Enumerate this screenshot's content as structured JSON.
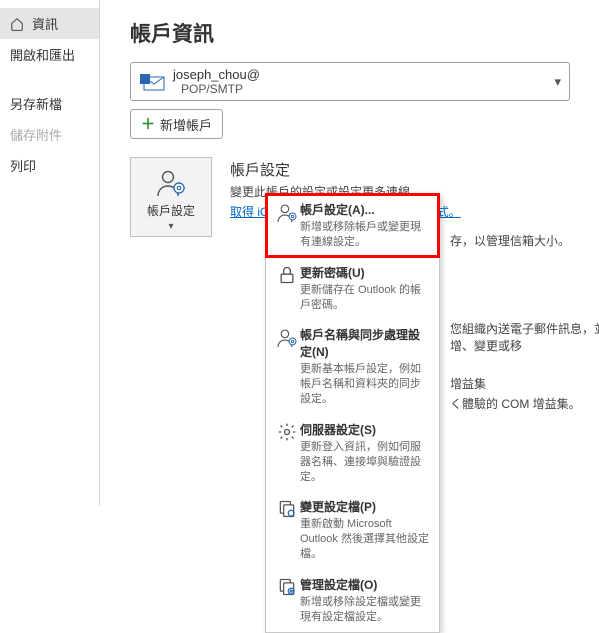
{
  "sidebar": {
    "items": [
      {
        "label": "資訊",
        "icon": "home"
      },
      {
        "label": "開啟和匯出"
      },
      {
        "label": "另存新檔"
      },
      {
        "label": "儲存附件"
      },
      {
        "label": "列印"
      }
    ]
  },
  "main": {
    "pageTitle": "帳戶資訊",
    "account": {
      "email": "joseph_chou@",
      "protocol": "POP/SMTP"
    },
    "addAccount": "新增帳戶",
    "settingsBtn": "帳戶設定",
    "settingsHeading": "帳戶設定",
    "settingsSub": "變更此帳戶的設定或設定更多連線。",
    "settingsLink": "取得 iOS 或 Android 版 Outlook 應用程式。"
  },
  "dropdown": {
    "items": [
      {
        "title": "帳戶設定(A)...",
        "desc": "新增或移除帳戶或變更現有連線設定。"
      },
      {
        "title": "更新密碼(U)",
        "desc": "更新儲存在 Outlook 的帳戶密碼。"
      },
      {
        "title": "帳戶名稱與同步處理設定(N)",
        "desc": "更新基本帳戶設定，例如帳戶名稱和資料夾的同步設定。"
      },
      {
        "title": "伺服器設定(S)",
        "desc": "更新登入資訊，例如伺服器名稱、連接埠與驗證設定。"
      },
      {
        "title": "變更設定檔(P)",
        "desc": "重新啟動 Microsoft Outlook 然後選擇其他設定檔。"
      },
      {
        "title": "管理設定檔(O)",
        "desc": "新增或移除設定檔或變更現有設定檔設定。"
      }
    ]
  },
  "bgText": {
    "t1": "存，以管理信箱大小。",
    "t2": "您組織內送電子郵件訊息，並讓您在項目新增、變更或移",
    "t3": "增益集",
    "t4": "く體驗的 COM 增益集。"
  }
}
